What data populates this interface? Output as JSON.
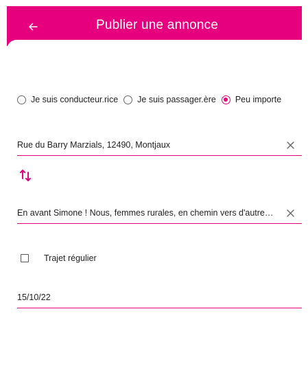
{
  "header": {
    "title": "Publier une annonce",
    "back_icon": "arrow-left-icon"
  },
  "role_options": [
    {
      "label": "Je suis conducteur.rice",
      "selected": false
    },
    {
      "label": "Je suis passager.ère",
      "selected": false
    },
    {
      "label": "Peu importe",
      "selected": true
    }
  ],
  "departure": {
    "value": "Rue du Barry Marzials, 12490, Montjaux"
  },
  "arrival": {
    "value": "En avant Simone ! Nous, femmes rurales, en chemin vers d'autres m…"
  },
  "regular_trip": {
    "label": "Trajet régulier",
    "checked": false
  },
  "date": {
    "value": "15/10/22"
  },
  "colors": {
    "accent": "#e6007e"
  }
}
